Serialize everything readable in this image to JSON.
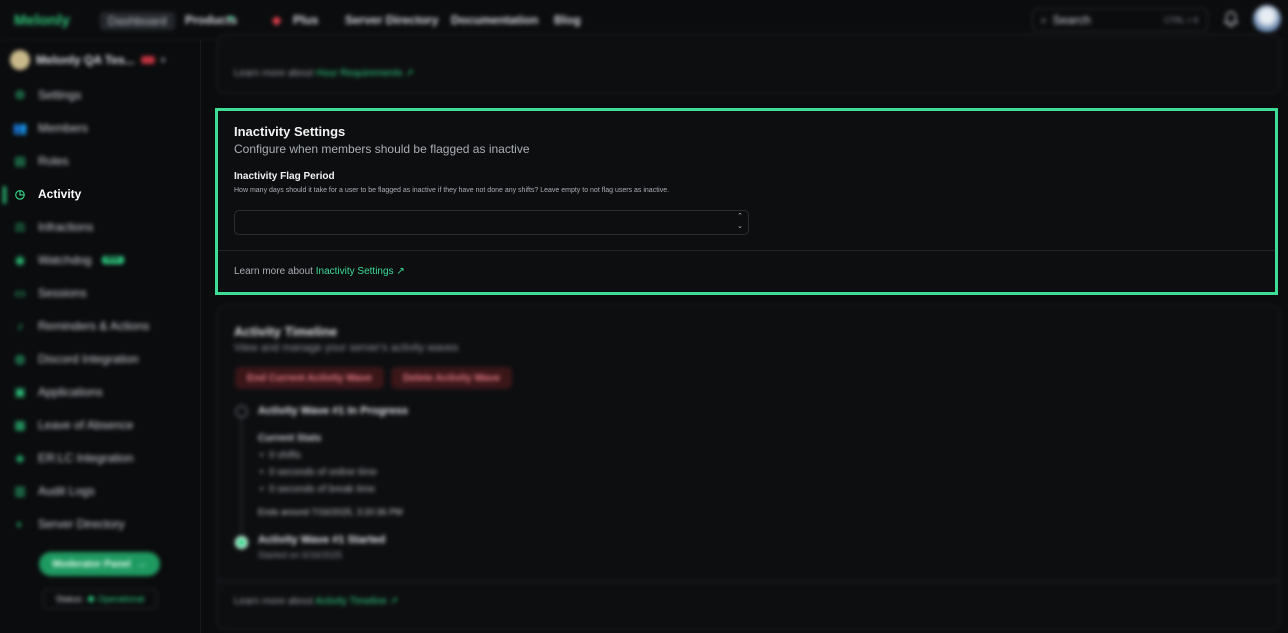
{
  "topbar": {
    "brand": "Melonly",
    "dashboard": "Dashboard",
    "nav": [
      "Products",
      "Plus",
      "Server Directory",
      "Documentation",
      "Blog"
    ],
    "search_label": "Search",
    "search_shortcut": "CTRL + K"
  },
  "sidebar": {
    "server_name": "Melonly QA Tes...",
    "items": [
      {
        "label": "Settings",
        "icon": "gear-icon"
      },
      {
        "label": "Members",
        "icon": "users-icon"
      },
      {
        "label": "Roles",
        "icon": "roles-icon"
      },
      {
        "label": "Activity",
        "icon": "clock-icon",
        "active": true
      },
      {
        "label": "Infractions",
        "icon": "gavel-icon"
      },
      {
        "label": "Watchdog",
        "icon": "watchdog-icon",
        "badge": "NEW"
      },
      {
        "label": "Sessions",
        "icon": "monitor-icon"
      },
      {
        "label": "Reminders & Actions",
        "icon": "bell-icon"
      },
      {
        "label": "Discord Integration",
        "icon": "discord-icon"
      },
      {
        "label": "Applications",
        "icon": "clipboard-icon"
      },
      {
        "label": "Leave of Absence",
        "icon": "calendar-icon"
      },
      {
        "label": "ER:LC Integration",
        "icon": "car-icon"
      },
      {
        "label": "Audit Logs",
        "icon": "log-icon"
      },
      {
        "label": "Server Directory",
        "icon": "directory-icon"
      }
    ],
    "moderator_panel": "Moderator Panel",
    "status_label": "Status:",
    "status_value": "Operational"
  },
  "top_card": {
    "learn_prefix": "Learn more about",
    "learn_link": "Hour Requirements"
  },
  "inactivity": {
    "title": "Inactivity Settings",
    "subtitle": "Configure when members should be flagged as inactive",
    "field_label": "Inactivity Flag Period",
    "field_help": "How many days should it take for a user to be flagged as inactive if they have not done any shifts? Leave empty to not flag users as inactive.",
    "field_value": "",
    "learn_prefix": "Learn more about",
    "learn_link": "Inactivity Settings"
  },
  "timeline": {
    "title": "Activity Timeline",
    "subtitle": "View and manage your server's activity waves",
    "end_button": "End Current Activity Wave",
    "delete_button": "Delete Activity Wave",
    "wave_in_progress": "Activity Wave #1 In Progress",
    "current_stats": "Current Stats",
    "stats": [
      "0 shifts",
      "0 seconds of online time",
      "0 seconds of break time"
    ],
    "ends_around": "Ends around 7/16/2025, 3:20:36 PM",
    "wave_started": "Activity Wave #1 Started",
    "started_on": "Started on 6/16/2025",
    "learn_prefix": "Learn more about",
    "learn_link": "Activity Timeline"
  },
  "colors": {
    "accent": "#3ddc97",
    "danger_bg": "#3a1619",
    "danger_text": "#e57b84"
  }
}
